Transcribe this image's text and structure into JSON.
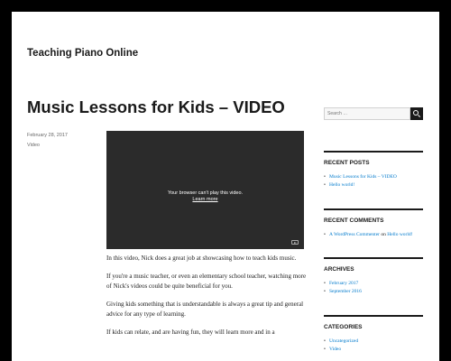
{
  "site": {
    "title": "Teaching Piano Online"
  },
  "post": {
    "title": "Music Lessons for Kids – VIDEO",
    "date": "February 28, 2017",
    "category": "Video",
    "video": {
      "message": "Your browser can't play this video.",
      "link": "Learn more"
    },
    "paragraphs": [
      "In this video, Nick does a great job at showcasing how to teach kids music.",
      "If you're a music teacher, or even an elementary school teacher, watching more of Nick's videos could be quite beneficial for you.",
      "Giving kids something that is understandable is always a great tip and general advice for any type of learning.",
      "If kids can relate, and are having fun, they will learn more and in a"
    ]
  },
  "sidebar": {
    "search": {
      "placeholder": "Search …"
    },
    "recent_posts": {
      "title": "RECENT POSTS",
      "items": [
        "Music Lessons for Kids – VIDEO",
        "Hello world!"
      ]
    },
    "recent_comments": {
      "title": "RECENT COMMENTS",
      "author": "A WordPress Commenter",
      "on": "on",
      "post": "Hello world!"
    },
    "archives": {
      "title": "ARCHIVES",
      "items": [
        "February 2017",
        "September 2016"
      ]
    },
    "categories": {
      "title": "CATEGORIES",
      "items": [
        "Uncategorized",
        "Video"
      ]
    }
  },
  "colors": {
    "frame": "#000000",
    "link": "#007acc",
    "text": "#1a1a1a",
    "video_bg": "#2b2b2b"
  },
  "icons": {
    "search": "search-icon",
    "youtube": "youtube-icon"
  }
}
